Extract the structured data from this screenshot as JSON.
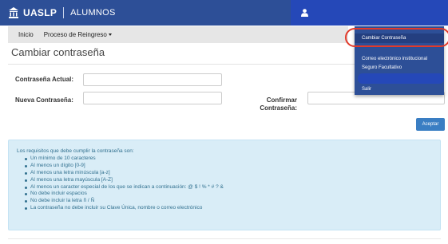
{
  "navbar": {
    "brand_title": "UASLP",
    "brand_subtitle": "ALUMNOS",
    "brand_icon": "university-building-icon",
    "user_icon": "user-icon",
    "color": "#2d4f97"
  },
  "subnav": {
    "items": [
      "Inicio",
      "Proceso de Reingreso"
    ]
  },
  "dropdown": {
    "items": [
      "Cambiar Contraseña",
      "Correo electrónico institucional",
      "Seguro Facultativo",
      "",
      "Salir"
    ],
    "active_index": 0
  },
  "page": {
    "title": "Cambiar contraseña"
  },
  "form": {
    "current_label": "Contraseña Actual:",
    "new_label": "Nueva Contraseña:",
    "confirm_label_line1": "Confirmar",
    "confirm_label_line2": "Contraseña:",
    "current_value": "",
    "new_value": "",
    "confirm_value": "",
    "submit_label": "Aceptar",
    "submit_color": "#3a7ec3"
  },
  "requirements": {
    "intro": "Los requisitos que debe cumplir la contraseña son:",
    "items": [
      "Un mínimo de 10 caracteres",
      "Al menos un dígito [0-9]",
      "Al menos una letra minúscula [a-z]",
      "Al menos una letra mayúscula [A-Z]",
      "Al menos un caracter especial de los que se indican a continuación: @ $ ! % * # ? &",
      "No debe incluir espacios",
      "No debe incluir la letra ñ / Ñ",
      "La contraseña no debe incluir su Clave Única, nombre o correo electrónico"
    ],
    "background": "#d9edf7"
  }
}
